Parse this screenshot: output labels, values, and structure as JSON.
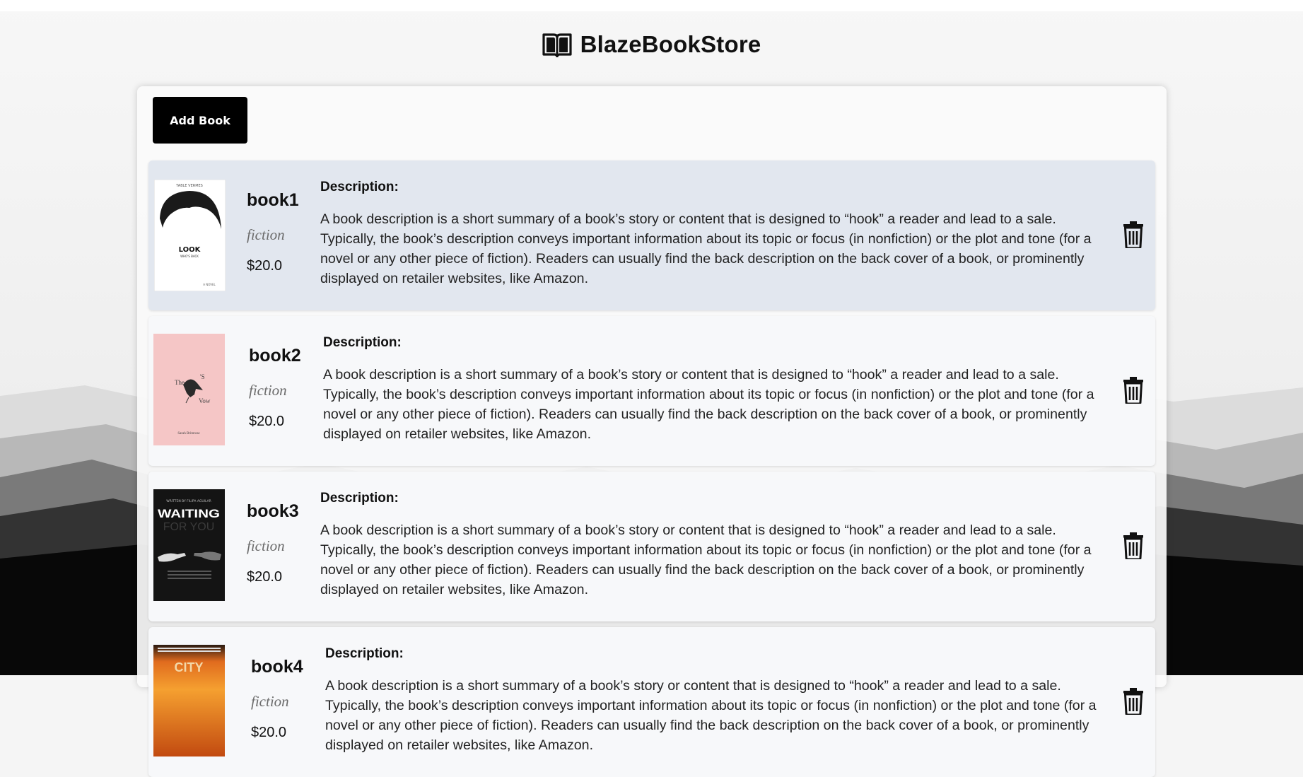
{
  "app": {
    "title": "BlazeBookStore"
  },
  "toolbar": {
    "add_label": "Add Book"
  },
  "books": [
    {
      "name": "book1",
      "genre": "fiction",
      "price": "$20.0",
      "desc_label": "Description:",
      "desc": "A book description is a short summary of a book’s story or content that is designed to “hook” a reader and lead to a sale. Typically, the book’s description conveys important information about its topic or focus (in nonfiction) or the plot and tone (for a novel or any other piece of fiction). Readers can usually find the back description on the back cover of a book, or prominently displayed on retailer websites, like Amazon.",
      "cover": {
        "top_text": "TABLE VERMES",
        "title": "LOOK",
        "subtitle": "WHO'S BACK",
        "bottom": "A NOVEL"
      }
    },
    {
      "name": "book2",
      "genre": "fiction",
      "price": "$20.0",
      "desc_label": "Description:",
      "desc": "A book description is a short summary of a book’s story or content that is designed to “hook” a reader and lead to a sale. Typically, the book’s description conveys important information about its topic or focus (in nonfiction) or the plot and tone (for a novel or any other piece of fiction). Readers can usually find the back description on the back cover of a book, or prominently displayed on retailer websites, like Amazon.",
      "cover": {
        "t1": "The",
        "t2": "'S",
        "t3": "Vow",
        "author": "Sarah Brimrose"
      }
    },
    {
      "name": "book3",
      "genre": "fiction",
      "price": "$20.0",
      "desc_label": "Description:",
      "desc": "A book description is a short summary of a book’s story or content that is designed to “hook” a reader and lead to a sale. Typically, the book’s description conveys important information about its topic or focus (in nonfiction) or the plot and tone (for a novel or any other piece of fiction). Readers can usually find the back description on the back cover of a book, or prominently displayed on retailer websites, like Amazon.",
      "cover": {
        "top": "WRITTEN BY FILIPA AGUILAR",
        "title1": "WAITING",
        "title2": "FOR YOU"
      }
    },
    {
      "name": "book4",
      "genre": "fiction",
      "price": "$20.0",
      "desc_label": "Description:",
      "desc": "A book description is a short summary of a book’s story or content that is designed to “hook” a reader and lead to a sale. Typically, the book’s description conveys important information about its topic or focus (in nonfiction) or the plot and tone (for a novel or any other piece of fiction). Readers can usually find the back description on the back cover of a book, or prominently displayed on retailer websites, like Amazon.",
      "cover": {
        "title": "CITY"
      }
    }
  ],
  "colors": {
    "active_card": "#e2e7ef",
    "card": "#f7f8fa",
    "button": "#000000"
  },
  "icons": {
    "logo": "open-book-icon",
    "delete": "trash-icon"
  }
}
